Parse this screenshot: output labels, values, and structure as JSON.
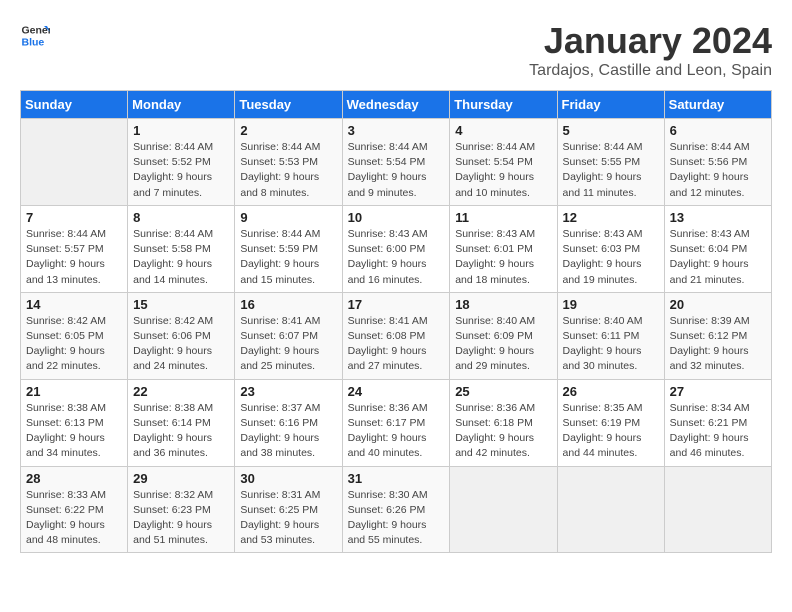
{
  "header": {
    "logo_general": "General",
    "logo_blue": "Blue",
    "title": "January 2024",
    "subtitle": "Tardajos, Castille and Leon, Spain"
  },
  "calendar": {
    "days_of_week": [
      "Sunday",
      "Monday",
      "Tuesday",
      "Wednesday",
      "Thursday",
      "Friday",
      "Saturday"
    ],
    "weeks": [
      [
        {
          "day": "",
          "info": ""
        },
        {
          "day": "1",
          "info": "Sunrise: 8:44 AM\nSunset: 5:52 PM\nDaylight: 9 hours\nand 7 minutes."
        },
        {
          "day": "2",
          "info": "Sunrise: 8:44 AM\nSunset: 5:53 PM\nDaylight: 9 hours\nand 8 minutes."
        },
        {
          "day": "3",
          "info": "Sunrise: 8:44 AM\nSunset: 5:54 PM\nDaylight: 9 hours\nand 9 minutes."
        },
        {
          "day": "4",
          "info": "Sunrise: 8:44 AM\nSunset: 5:54 PM\nDaylight: 9 hours\nand 10 minutes."
        },
        {
          "day": "5",
          "info": "Sunrise: 8:44 AM\nSunset: 5:55 PM\nDaylight: 9 hours\nand 11 minutes."
        },
        {
          "day": "6",
          "info": "Sunrise: 8:44 AM\nSunset: 5:56 PM\nDaylight: 9 hours\nand 12 minutes."
        }
      ],
      [
        {
          "day": "7",
          "info": "Sunrise: 8:44 AM\nSunset: 5:57 PM\nDaylight: 9 hours\nand 13 minutes."
        },
        {
          "day": "8",
          "info": "Sunrise: 8:44 AM\nSunset: 5:58 PM\nDaylight: 9 hours\nand 14 minutes."
        },
        {
          "day": "9",
          "info": "Sunrise: 8:44 AM\nSunset: 5:59 PM\nDaylight: 9 hours\nand 15 minutes."
        },
        {
          "day": "10",
          "info": "Sunrise: 8:43 AM\nSunset: 6:00 PM\nDaylight: 9 hours\nand 16 minutes."
        },
        {
          "day": "11",
          "info": "Sunrise: 8:43 AM\nSunset: 6:01 PM\nDaylight: 9 hours\nand 18 minutes."
        },
        {
          "day": "12",
          "info": "Sunrise: 8:43 AM\nSunset: 6:03 PM\nDaylight: 9 hours\nand 19 minutes."
        },
        {
          "day": "13",
          "info": "Sunrise: 8:43 AM\nSunset: 6:04 PM\nDaylight: 9 hours\nand 21 minutes."
        }
      ],
      [
        {
          "day": "14",
          "info": "Sunrise: 8:42 AM\nSunset: 6:05 PM\nDaylight: 9 hours\nand 22 minutes."
        },
        {
          "day": "15",
          "info": "Sunrise: 8:42 AM\nSunset: 6:06 PM\nDaylight: 9 hours\nand 24 minutes."
        },
        {
          "day": "16",
          "info": "Sunrise: 8:41 AM\nSunset: 6:07 PM\nDaylight: 9 hours\nand 25 minutes."
        },
        {
          "day": "17",
          "info": "Sunrise: 8:41 AM\nSunset: 6:08 PM\nDaylight: 9 hours\nand 27 minutes."
        },
        {
          "day": "18",
          "info": "Sunrise: 8:40 AM\nSunset: 6:09 PM\nDaylight: 9 hours\nand 29 minutes."
        },
        {
          "day": "19",
          "info": "Sunrise: 8:40 AM\nSunset: 6:11 PM\nDaylight: 9 hours\nand 30 minutes."
        },
        {
          "day": "20",
          "info": "Sunrise: 8:39 AM\nSunset: 6:12 PM\nDaylight: 9 hours\nand 32 minutes."
        }
      ],
      [
        {
          "day": "21",
          "info": "Sunrise: 8:38 AM\nSunset: 6:13 PM\nDaylight: 9 hours\nand 34 minutes."
        },
        {
          "day": "22",
          "info": "Sunrise: 8:38 AM\nSunset: 6:14 PM\nDaylight: 9 hours\nand 36 minutes."
        },
        {
          "day": "23",
          "info": "Sunrise: 8:37 AM\nSunset: 6:16 PM\nDaylight: 9 hours\nand 38 minutes."
        },
        {
          "day": "24",
          "info": "Sunrise: 8:36 AM\nSunset: 6:17 PM\nDaylight: 9 hours\nand 40 minutes."
        },
        {
          "day": "25",
          "info": "Sunrise: 8:36 AM\nSunset: 6:18 PM\nDaylight: 9 hours\nand 42 minutes."
        },
        {
          "day": "26",
          "info": "Sunrise: 8:35 AM\nSunset: 6:19 PM\nDaylight: 9 hours\nand 44 minutes."
        },
        {
          "day": "27",
          "info": "Sunrise: 8:34 AM\nSunset: 6:21 PM\nDaylight: 9 hours\nand 46 minutes."
        }
      ],
      [
        {
          "day": "28",
          "info": "Sunrise: 8:33 AM\nSunset: 6:22 PM\nDaylight: 9 hours\nand 48 minutes."
        },
        {
          "day": "29",
          "info": "Sunrise: 8:32 AM\nSunset: 6:23 PM\nDaylight: 9 hours\nand 51 minutes."
        },
        {
          "day": "30",
          "info": "Sunrise: 8:31 AM\nSunset: 6:25 PM\nDaylight: 9 hours\nand 53 minutes."
        },
        {
          "day": "31",
          "info": "Sunrise: 8:30 AM\nSunset: 6:26 PM\nDaylight: 9 hours\nand 55 minutes."
        },
        {
          "day": "",
          "info": ""
        },
        {
          "day": "",
          "info": ""
        },
        {
          "day": "",
          "info": ""
        }
      ]
    ]
  }
}
